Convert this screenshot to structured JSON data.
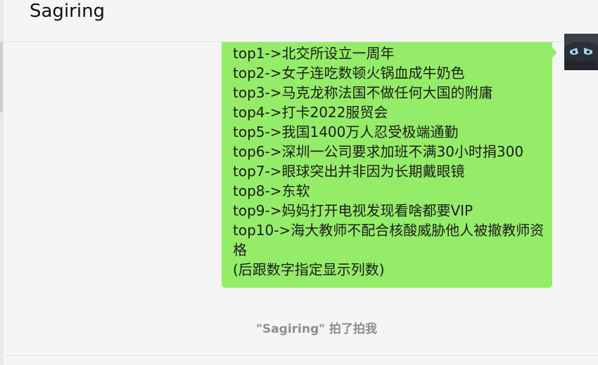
{
  "header": {
    "title": "Sagiring"
  },
  "message": {
    "lines": [
      "top1->北交所设立一周年",
      "top2->女子连吃数顿火锅血成牛奶色",
      "top3->马克龙称法国不做任何大国的附庸",
      "top4->打卡2022服贸会",
      "top5->我国1400万人忍受极端通勤",
      "top6->深圳一公司要求加班不满30小时捐300",
      "top7->眼球突出并非因为长期戴眼镜",
      "top8->东软",
      "top9->妈妈打开电视发现看啥都要VIP",
      "top10->海大教师不配合核酸威胁他人被撤教师资格",
      "(后跟数字指定显示列数)"
    ],
    "bubble_color": "#95ec69"
  },
  "avatar": {
    "icon": "avatar-icon"
  },
  "system_note": "\"Sagiring\" 拍了拍我"
}
